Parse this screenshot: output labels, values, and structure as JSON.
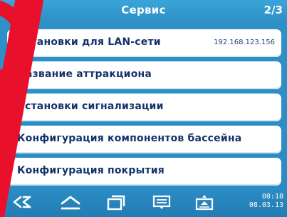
{
  "header": {
    "title": "Сервис",
    "page": "2/3"
  },
  "menu": [
    {
      "label": "Установки для LAN-сети",
      "value": "192.168.123.156"
    },
    {
      "label": "Название аттракциона"
    },
    {
      "label": "Установки сигнализации"
    },
    {
      "label": "Конфигурация компонентов бассейна"
    },
    {
      "label": "Конфигурация покрытия"
    }
  ],
  "footer": {
    "icons": [
      "back-icon",
      "home-icon",
      "windows-icon",
      "menu-icon",
      "eject-icon"
    ],
    "time": "08:18",
    "date": "08.03.13"
  },
  "colors": {
    "accent": "#2d92c9",
    "text": "#13346a",
    "watermark": "#e8102a"
  }
}
